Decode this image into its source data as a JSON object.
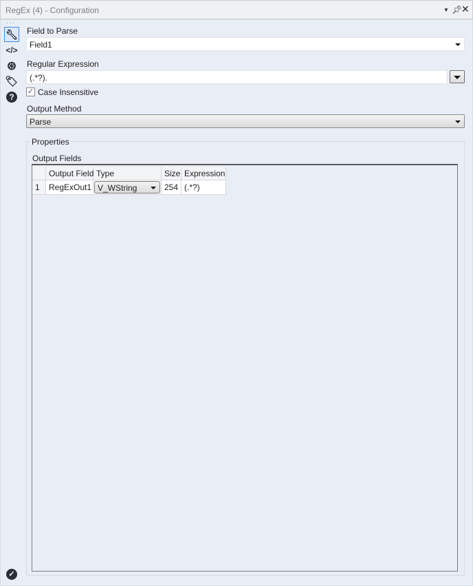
{
  "window": {
    "title": "RegEx (4) - Configuration"
  },
  "sidebar": {
    "icons": [
      "wrench-icon",
      "code-icon",
      "compass-icon",
      "tag-icon",
      "help-icon"
    ],
    "bottom": "check-circle-icon"
  },
  "field_to_parse": {
    "label": "Field to Parse",
    "value": "Field1"
  },
  "regex": {
    "label": "Regular Expression",
    "value": "(.*?)."
  },
  "case_insensitive": {
    "label": "Case Insensitive",
    "checked": true
  },
  "output_method": {
    "label": "Output Method",
    "value": "Parse"
  },
  "properties": {
    "label": "Properties",
    "output_fields_label": "Output Fields",
    "columns": [
      "Output Field",
      "Type",
      "Size",
      "Expression"
    ],
    "rows": [
      {
        "num": "1",
        "field": "RegExOut1",
        "type": "V_WString",
        "size": "254",
        "expression": "(.*?)"
      }
    ]
  }
}
